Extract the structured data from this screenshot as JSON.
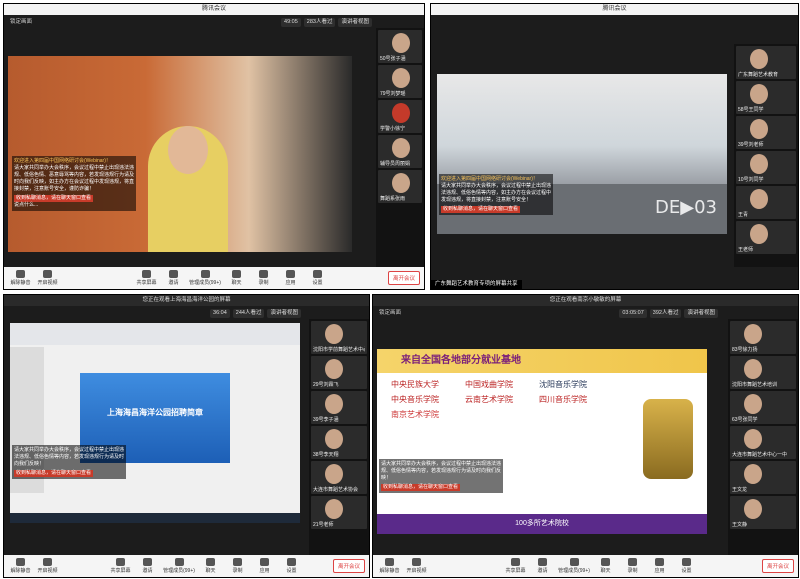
{
  "toolbar_labels": {
    "mute": "解除静音",
    "video": "开启视频",
    "share": "共享屏幕",
    "invite": "邀请",
    "manage": "管理成员(99+)",
    "chat": "聊天",
    "record": "录制",
    "apps": "应用",
    "settings": "设置",
    "leave": "离开会议"
  },
  "a": {
    "title": "腾讯会议",
    "time": "49:05",
    "viewers": "283人看过",
    "view": "演讲者视图",
    "speaker": "锁定画面",
    "notice": "欢迎进入第四届中国网络研讨会(Webinar)！",
    "msg": "请大家共同举办大会秩序，会议过程中禁止出现违法违规、低俗色情、恶意辱骂等内容，若发现违规行为请及时向我们反映，如主办方在会议过程中发现违规，将直接封禁，注意账号安全，谨防诈骗！",
    "hint": "收到私聊消息，请在聊天窗口查看",
    "hint_sub": "说点什么...",
    "participants": [
      "50号张子涵",
      "79号刘梦瑶",
      "学警小徐宁",
      "辅导员周丽娟",
      "舞蹈系张雨"
    ]
  },
  "b": {
    "title": "腾讯会议",
    "notice": "欢迎进入第四届中国网络研讨会(Webinar)！",
    "msg": "请大家共同举办大会秩序，会议过程中禁止出现违法违规、低俗色情等内容，如主办方在会议过程中发现违规，将直接封禁，注意账号安全！",
    "hint": "收到私聊消息，请在聊天窗口查看",
    "participants": [
      "广东舞蹈艺术教育",
      "58号王同学",
      "39号刘老师",
      "10号刘同学",
      "王青",
      "王老师"
    ],
    "banner": "广东舞蹈艺术教育专项的屏幕共享",
    "logo": "DE▶03"
  },
  "c": {
    "top_notice": "您正在观看上海海昌海洋公园的屏幕",
    "time": "36:04",
    "viewers": "244人看过",
    "view": "演讲者视图",
    "msg": "请大家共同举办大会秩序，会议过程中禁止出现违法违规、低俗色情等内容，若发现违规行为请及时向我们反映！",
    "hint": "收到私聊消息，请在聊天窗口查看",
    "participants": [
      "沈阳市学前舞蹈艺术中心",
      "29号刘霖飞",
      "39号李子涵",
      "38号李天翔",
      "大连市舞蹈艺术协会",
      "21号老师"
    ],
    "share_title": "上海海昌海洋公园招聘简章"
  },
  "d": {
    "top_notice": "您正在观看南京小敏敏的屏幕",
    "time": "03:05:07",
    "viewers": "392人看过",
    "view": "演讲者视图",
    "speaker": "锁定画面",
    "msg": "请大家共同举办大会秩序，会议过程中禁止出现违法违规、低俗色情等内容，若发现违规行为请及时向我们反映！",
    "hint": "收到私聊消息，请在聊天窗口查看",
    "participants": [
      "83号徐力扬",
      "沈阳市舞蹈艺术培训",
      "63号张同学",
      "大连市舞蹈艺术中心一中",
      "王文龙",
      "王文静"
    ],
    "share_title": "来自全国各地部分就业基地",
    "schools": [
      "中央民族大学",
      "中国戏曲学院",
      "沈阳音乐学院",
      "中央音乐学院",
      "云南艺术学院",
      "四川音乐学院",
      "南京艺术学院"
    ],
    "footer": "100多所艺术院校"
  }
}
